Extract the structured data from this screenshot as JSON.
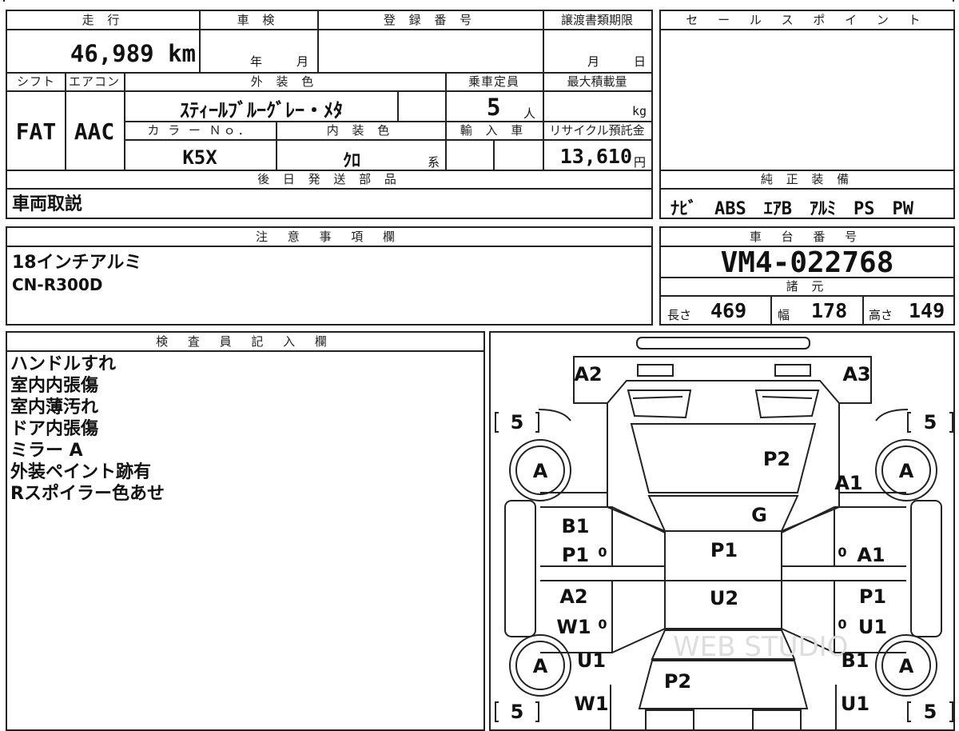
{
  "specs": {
    "mileage_label": "走 行",
    "mileage": "46,989 km",
    "inspection_label": "車 検",
    "inspection_year": "年",
    "inspection_month": "月",
    "registration_label": "登 録 番 号",
    "transfer_label": "譲渡書類期限",
    "transfer_month": "月",
    "transfer_day": "日",
    "shift_label": "シフト",
    "shift": "FAT",
    "ac_label": "エアコン",
    "ac": "AAC",
    "exterior_label": "外 装 色",
    "exterior_color": "ｽﾃｨｰﾙﾌﾞﾙｰｸﾞﾚｰ・ﾒﾀ",
    "capacity_label": "乗車定員",
    "capacity": "5",
    "capacity_unit": "人",
    "max_load_label": "最大積載量",
    "max_load_unit": "kg",
    "color_no_label": "カ ラ ー Ｎｏ．",
    "color_no": "K5X",
    "interior_label": "内 装 色",
    "interior_color": "ｸﾛ",
    "interior_suffix": "系",
    "import_label": "輸 入 車",
    "recycle_label": "リサイクル預託金",
    "recycle": "13,610",
    "recycle_unit": "円",
    "later_parts_label": "後 日 発 送 部 品",
    "later_parts": "車両取説"
  },
  "sales": {
    "label": "セ ー ル ス ポ イ ン ト",
    "equipment_label": "純 正 装 備",
    "equipment": "ﾅﾋﾞ　ABS　ｴｱB　ｱﾙﾐ　PS　PW"
  },
  "notes": {
    "label": "注 意 事 項 欄",
    "lines": [
      "18インチアルミ",
      "CN-R300D"
    ]
  },
  "chassis": {
    "label": "車 台 番 号",
    "number": "VM4-022768",
    "dims_label": "諸 元",
    "length_label": "長さ",
    "length": "469",
    "width_label": "幅",
    "width": "178",
    "height_label": "高さ",
    "height": "149"
  },
  "inspector": {
    "label": "検 査 員 記 入 欄",
    "lines": [
      "ハンドルすれ",
      "室内内張傷",
      "室内薄汚れ",
      "ドア内張傷",
      "ミラー A",
      "外装ペイント跡有",
      "Rスポイラー色あせ"
    ]
  },
  "diagram": {
    "codes": {
      "front_left": "A2",
      "front_right": "A3",
      "hood": "P2",
      "fender_right": "A1",
      "windshield": "G",
      "front_door_left_1": "B1",
      "front_door_left_2": "P1",
      "roof": "P1",
      "front_door_right": "A1",
      "rear_door_left_1": "A2",
      "rear_door_left_2": "W1",
      "roof_rear": "U2",
      "rear_door_right_1": "P1",
      "rear_door_right_2": "U1",
      "rear_left_1": "U1",
      "rear_left_2": "W1",
      "trunk": "P2",
      "rear_right_1": "B1",
      "rear_right_2": "U1"
    },
    "wheel_grade": "A",
    "tread": "5",
    "door_marker": "0",
    "watermark": "WEB STUDIO"
  }
}
